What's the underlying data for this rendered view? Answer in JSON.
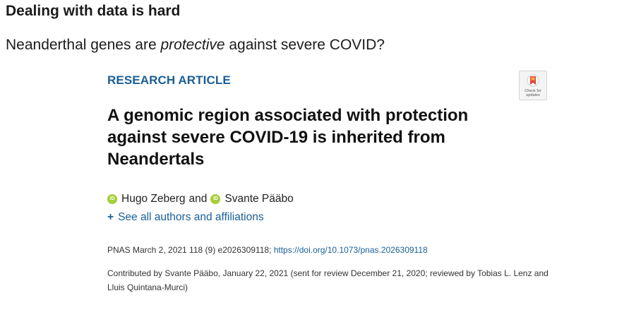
{
  "slide": {
    "title": "Dealing with data is hard",
    "subtitle_before": "Neanderthal genes are ",
    "subtitle_emphasis": "protective",
    "subtitle_after": " against severe COVID?"
  },
  "article": {
    "type_label": "RESEARCH ARTICLE",
    "badge_text": "Check for updates",
    "title": "A genomic region associated with protection against severe COVID-19 is inherited from Neandertals",
    "authors": [
      {
        "name": "Hugo Zeberg",
        "icon": "orcid-icon"
      },
      {
        "name": "Svante Pääbo",
        "icon": "orcid-icon"
      }
    ],
    "author_separator": "and",
    "see_all_label": "See all authors and affiliations",
    "citation_text": "PNAS March 2, 2021 118 (9) e2026309118; ",
    "doi": "https://doi.org/10.1073/pnas.2026309118",
    "contributed": "Contributed by Svante Pääbo, January 22, 2021 (sent for review December 21, 2020; reviewed by Tobias L. Lenz and Lluis Quintana-Murci)"
  },
  "colors": {
    "link_blue": "#1a5f96",
    "orcid_green": "#a6ce39",
    "badge_red": "#e0463a"
  }
}
